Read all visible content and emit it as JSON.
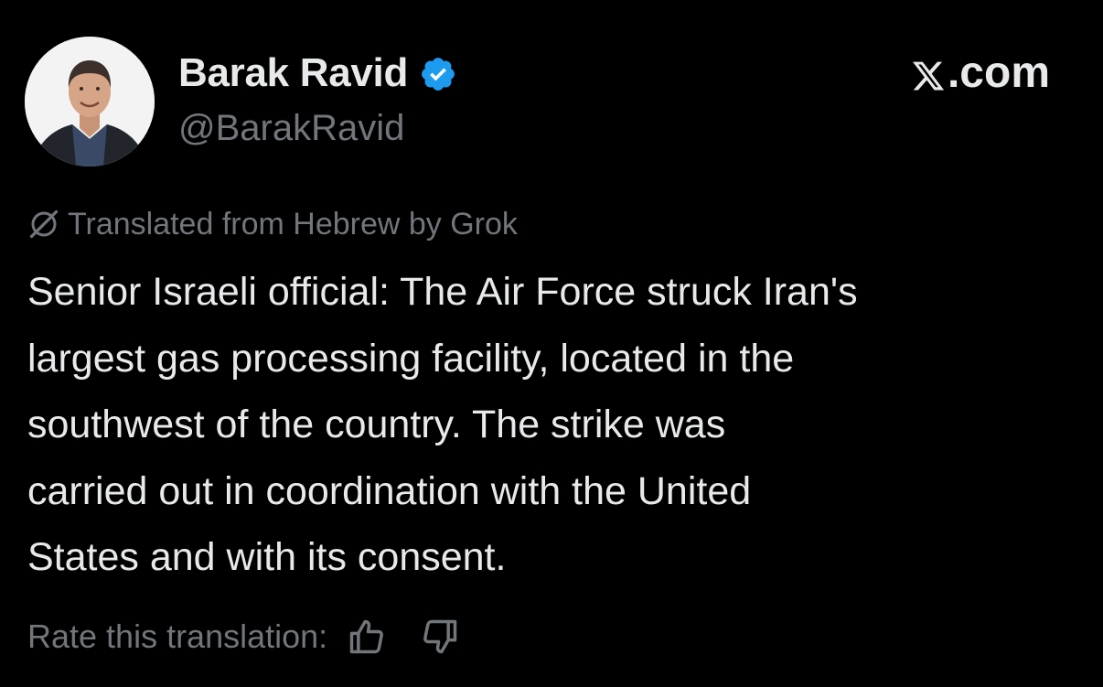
{
  "author": {
    "display_name": "Barak Ravid",
    "handle": "@BarakRavid",
    "verified": true,
    "verified_color": "#1d9bf0"
  },
  "site": {
    "label": ".com"
  },
  "translation": {
    "note": "Translated from Hebrew by Grok",
    "icon": "grok-icon"
  },
  "tweet": {
    "lines": [
      "Senior Israeli official: The Air Force struck Iran's",
      "largest gas processing facility, located in the",
      "southwest of the country. The strike was",
      "carried out in coordination with the United",
      "States and with its consent."
    ]
  },
  "rating": {
    "label": "Rate this translation:",
    "up_icon": "thumbs-up-icon",
    "down_icon": "thumbs-down-icon"
  },
  "colors": {
    "background": "#000000",
    "primary_text": "#e7e9ea",
    "secondary_text": "#71767b"
  }
}
